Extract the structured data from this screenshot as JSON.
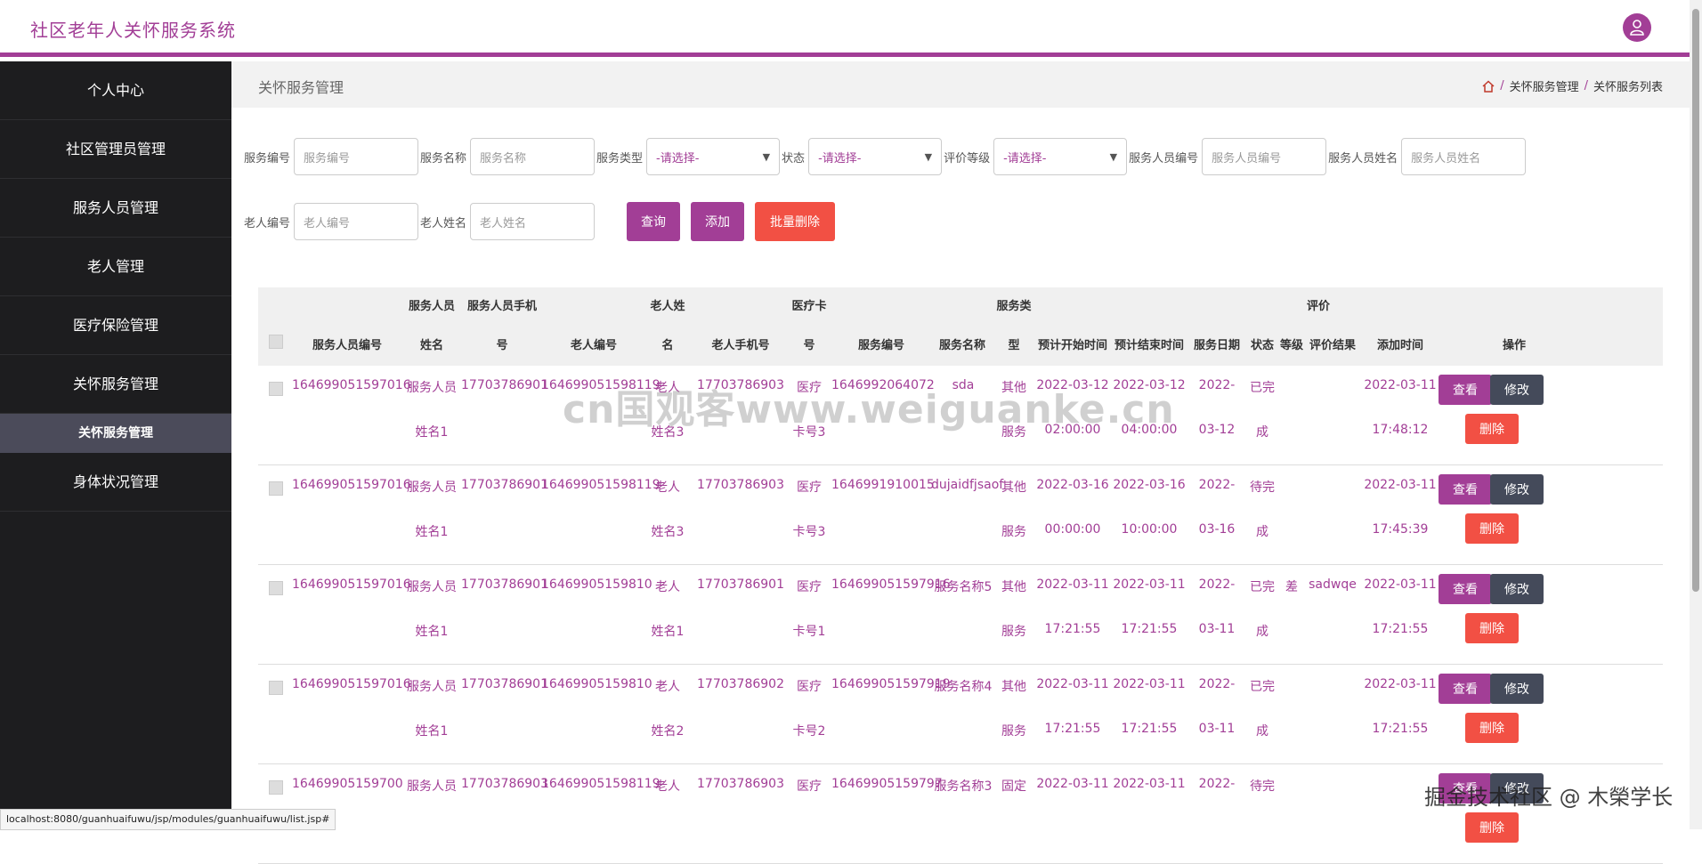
{
  "app": {
    "title": "社区老年人关怀服务系统"
  },
  "sidebar": {
    "items": [
      {
        "label": "个人中心"
      },
      {
        "label": "社区管理员管理"
      },
      {
        "label": "服务人员管理"
      },
      {
        "label": "老人管理"
      },
      {
        "label": "医疗保险管理"
      },
      {
        "label": "关怀服务管理"
      }
    ],
    "sub_item": {
      "label": "关怀服务管理"
    },
    "after_items": [
      {
        "label": "身体状况管理"
      }
    ]
  },
  "page": {
    "title": "关怀服务管理",
    "breadcrumb": [
      "关怀服务管理",
      "关怀服务列表"
    ]
  },
  "filters": {
    "fields": [
      {
        "label": "服务编号",
        "placeholder": "服务编号"
      },
      {
        "label": "服务名称",
        "placeholder": "服务名称"
      },
      {
        "label": "服务类型",
        "value": "-请选择-"
      },
      {
        "label": "状态",
        "value": "-请选择-"
      },
      {
        "label": "评价等级",
        "value": "-请选择-"
      },
      {
        "label": "服务人员编号",
        "placeholder": "服务人员编号"
      },
      {
        "label": "服务人员姓名",
        "placeholder": "服务人员姓名"
      },
      {
        "label": "老人编号",
        "placeholder": "老人编号"
      },
      {
        "label": "老人姓名",
        "placeholder": "老人姓名"
      }
    ],
    "buttons": {
      "search": "查询",
      "add": "添加",
      "batch_delete": "批量删除"
    }
  },
  "table": {
    "headers": {
      "staff_no": "服务人员编号",
      "staff_name_1": "服务人员",
      "staff_name_2": "姓名",
      "staff_phone_1": "服务人员手机",
      "staff_phone_2": "号",
      "elder_no": "老人编号",
      "elder_name_1": "老人姓",
      "elder_name_2": "名",
      "elder_phone": "老人手机号",
      "card_1": "医疗卡",
      "card_2": "号",
      "service_no": "服务编号",
      "service_name": "服务名称",
      "service_type_1": "服务类",
      "service_type_2": "型",
      "start": "预计开始时间",
      "end": "预计结束时间",
      "date": "服务日期",
      "status": "状态",
      "rating_group": "评价",
      "level": "等级",
      "result": "评价结果",
      "added": "添加时间",
      "ops": "操作"
    },
    "actions": {
      "view": "查看",
      "edit": "修改",
      "delete": "删除"
    },
    "rows": [
      {
        "staff_no": "164699051597016",
        "staff_name_1": "服务人员",
        "staff_name_2": "姓名1",
        "staff_phone": "17703786901",
        "elder_no": "164699051598119",
        "elder_name_1": "老人",
        "elder_name_2": "姓名3",
        "elder_phone": "17703786903",
        "card_1": "医疗",
        "card_2": "卡号3",
        "service_no": "1646992064072",
        "service_name": "sda",
        "type_1": "其他",
        "type_2": "服务",
        "start_1": "2022-03-12",
        "start_2": "02:00:00",
        "end_1": "2022-03-12",
        "end_2": "04:00:00",
        "date_1": "2022-",
        "date_2": "03-12",
        "status_1": "已完",
        "status_2": "成",
        "level": "",
        "result": "",
        "added_1": "2022-03-11",
        "added_2": "17:48:12"
      },
      {
        "staff_no": "164699051597016",
        "staff_name_1": "服务人员",
        "staff_name_2": "姓名1",
        "staff_phone": "17703786901",
        "elder_no": "164699051598119",
        "elder_name_1": "老人",
        "elder_name_2": "姓名3",
        "elder_phone": "17703786903",
        "card_1": "医疗",
        "card_2": "卡号3",
        "service_no": "1646991910015",
        "service_name": "dujaidfjsaof",
        "type_1": "其他",
        "type_2": "服务",
        "start_1": "2022-03-16",
        "start_2": "00:00:00",
        "end_1": "2022-03-16",
        "end_2": "10:00:00",
        "date_1": "2022-",
        "date_2": "03-16",
        "status_1": "待完",
        "status_2": "成",
        "level": "",
        "result": "",
        "added_1": "2022-03-11",
        "added_2": "17:45:39"
      },
      {
        "staff_no": "164699051597016",
        "staff_name_1": "服务人员",
        "staff_name_2": "姓名1",
        "staff_phone": "17703786901",
        "elder_no": "16469905159810",
        "elder_name_1": "老人",
        "elder_name_2": "姓名1",
        "elder_phone": "17703786901",
        "card_1": "医疗",
        "card_2": "卡号1",
        "service_no": "164699051597916",
        "service_name": "服务名称5",
        "type_1": "其他",
        "type_2": "服务",
        "start_1": "2022-03-11",
        "start_2": "17:21:55",
        "end_1": "2022-03-11",
        "end_2": "17:21:55",
        "date_1": "2022-",
        "date_2": "03-11",
        "status_1": "已完",
        "status_2": "成",
        "level": "差",
        "result": "sadwqe",
        "added_1": "2022-03-11",
        "added_2": "17:21:55"
      },
      {
        "staff_no": "164699051597016",
        "staff_name_1": "服务人员",
        "staff_name_2": "姓名1",
        "staff_phone": "17703786901",
        "elder_no": "16469905159810",
        "elder_name_1": "老人",
        "elder_name_2": "姓名2",
        "elder_phone": "17703786902",
        "card_1": "医疗",
        "card_2": "卡号2",
        "service_no": "164699051597919",
        "service_name": "服务名称4",
        "type_1": "其他",
        "type_2": "服务",
        "start_1": "2022-03-11",
        "start_2": "17:21:55",
        "end_1": "2022-03-11",
        "end_2": "17:21:55",
        "date_1": "2022-",
        "date_2": "03-11",
        "status_1": "已完",
        "status_2": "成",
        "level": "",
        "result": "",
        "added_1": "2022-03-11",
        "added_2": "17:21:55"
      },
      {
        "staff_no": "16469905159700",
        "staff_name_1": "服务人员",
        "staff_name_2": "",
        "staff_phone": "17703786903",
        "elder_no": "164699051598119",
        "elder_name_1": "老人",
        "elder_name_2": "",
        "elder_phone": "17703786903",
        "card_1": "医疗",
        "card_2": "",
        "service_no": "16469905159797",
        "service_name": "服务名称3",
        "type_1": "固定",
        "type_2": "",
        "start_1": "2022-03-11",
        "start_2": "",
        "end_1": "2022-03-11",
        "end_2": "",
        "date_1": "2022-",
        "date_2": "",
        "status_1": "待完",
        "status_2": "",
        "level": "",
        "result": "",
        "added_1": "",
        "added_2": ""
      }
    ]
  },
  "status_url": "localhost:8080/guanhuaifuwu/jsp/modules/guanhuaifuwu/list.jsp#",
  "watermark": "cn国观客www.weiguanke.cn",
  "corner_mark": "掘金技术社区 @ 木榮学长"
}
